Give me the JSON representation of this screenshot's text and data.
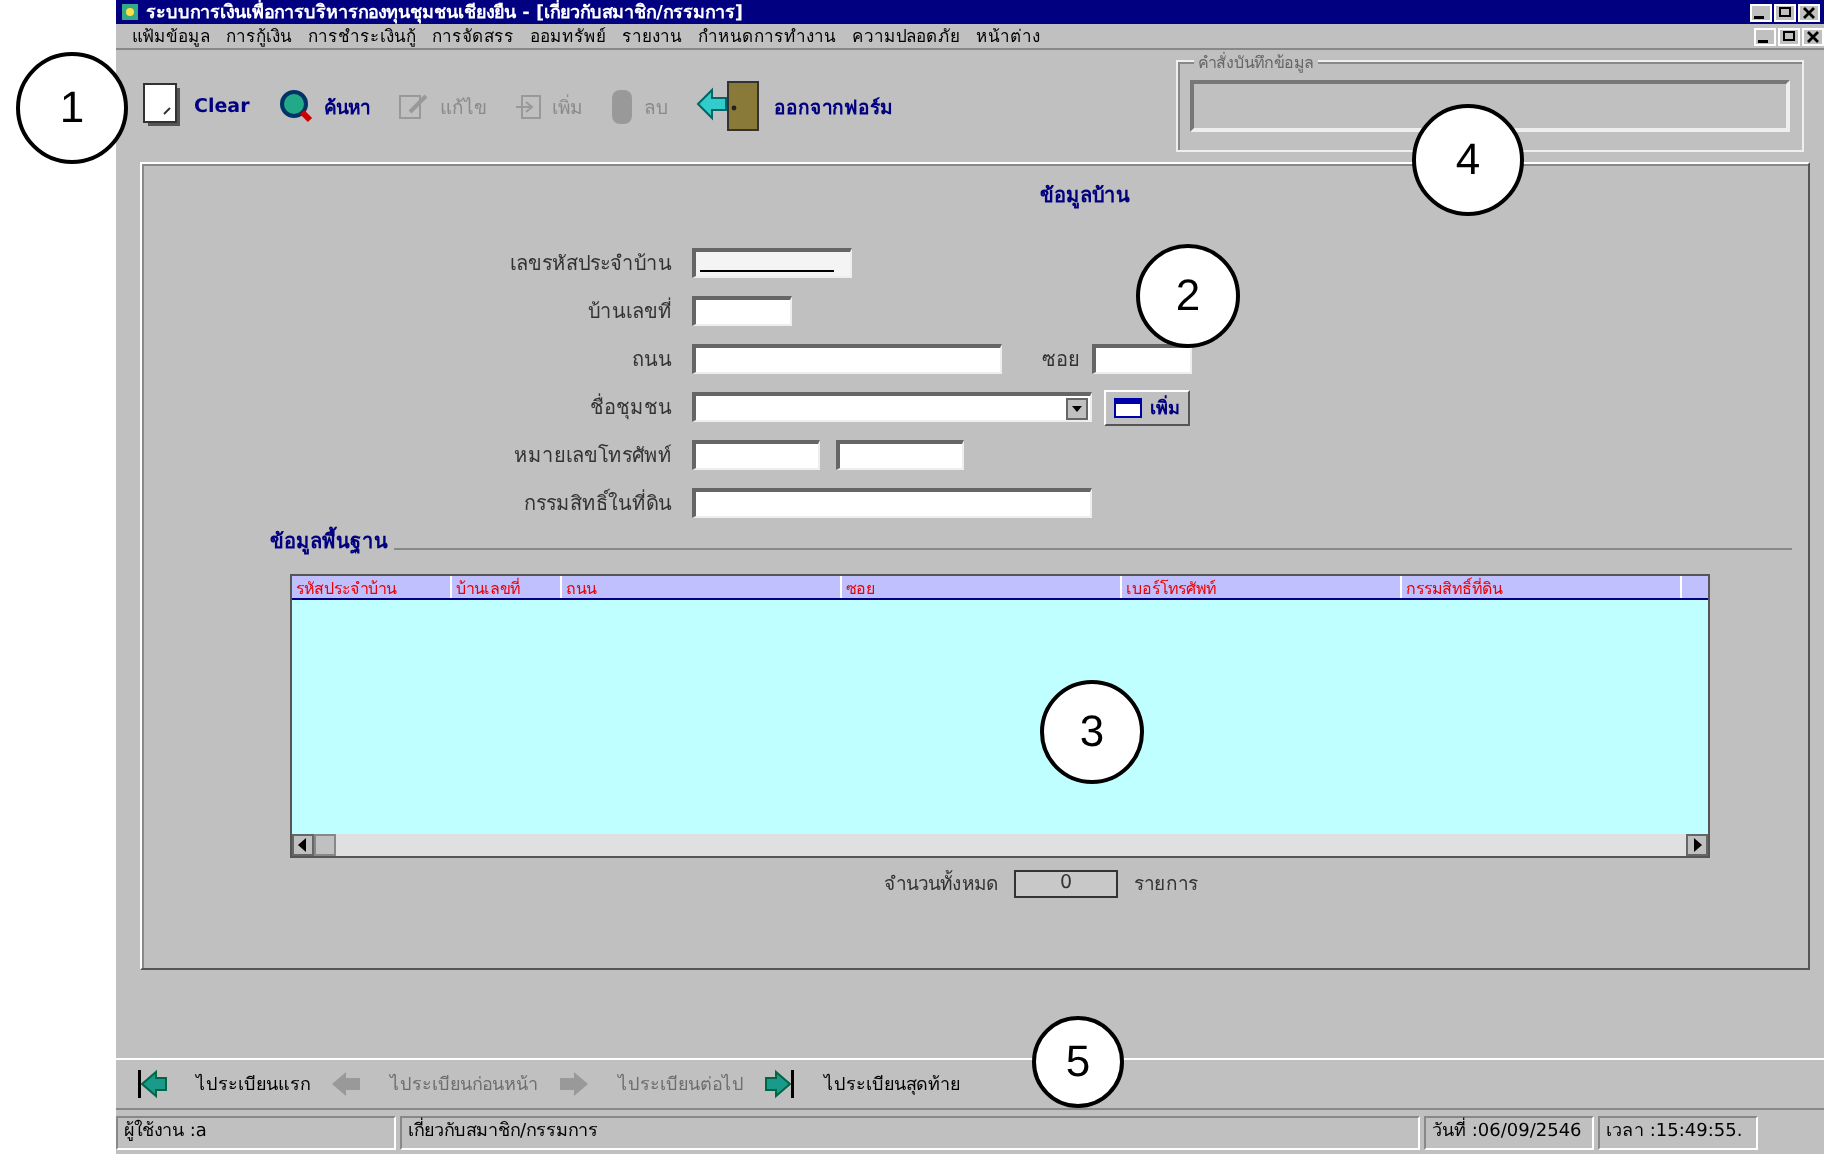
{
  "window": {
    "title": "ระบบการเงินเพื่อการบริหารกองทุนชุมชนเชียงยืน - [เกี่ยวกับสมาชิก/กรรมการ]"
  },
  "menu": [
    "แฟ้มข้อมูล",
    "การกู้เงิน",
    "การชำระเงินกู้",
    "การจัดสรร",
    "ออมทรัพย์",
    "รายงาน",
    "กำหนดการทำงาน",
    "ความปลอดภัย",
    "หน้าต่าง"
  ],
  "toolbar": [
    {
      "label": "Clear",
      "kind": "clear",
      "disabled": false
    },
    {
      "label": "ค้นหา",
      "kind": "search",
      "disabled": false
    },
    {
      "label": "แก้ไข",
      "kind": "edit",
      "disabled": true
    },
    {
      "label": "เพิ่ม",
      "kind": "add",
      "disabled": true
    },
    {
      "label": "ลบ",
      "kind": "delete",
      "disabled": true
    },
    {
      "label": "ออกจากฟอร์ม",
      "kind": "exit",
      "disabled": false
    }
  ],
  "record_group": {
    "label": "คำสั่งบันทึกข้อมูล"
  },
  "form": {
    "title": "ข้อมูลบ้าน",
    "rows": [
      [
        {
          "label": "เลขรหัสประจำบ้าน",
          "kind": "code"
        }
      ],
      [
        {
          "label": "บ้านเลขที่",
          "kind": "short"
        }
      ],
      [
        {
          "label": "ถนน",
          "kind": "medium"
        },
        {
          "label": "ซอย",
          "kind": "short"
        }
      ],
      [
        {
          "label": "ชื่อชุมชน",
          "kind": "combo",
          "button": "เพิ่ม"
        }
      ],
      [
        {
          "label": "หมายเลขโทรศัพท์",
          "kind": "phone"
        }
      ],
      [
        {
          "label": "กรรมสิทธิ์ในที่ดิน",
          "kind": "long"
        }
      ]
    ]
  },
  "basic": {
    "title": "ข้อมูลพื้นฐาน",
    "columns": [
      "รหัสประจำบ้าน",
      "บ้านเลขที่",
      "ถนน",
      "ซอย",
      "เบอร์โทรศัพท์",
      "กรรมสิทธิ์ที่ดิน"
    ],
    "count_label": "จำนวนทั้งหมด",
    "count": "0",
    "count_unit": "รายการ"
  },
  "nav": [
    {
      "label": "ไประเบียนแรก",
      "kind": "first",
      "disabled": false
    },
    {
      "label": "ไประเบียนก่อนหน้า",
      "kind": "prev",
      "disabled": true
    },
    {
      "label": "ไประเบียนต่อไป",
      "kind": "next",
      "disabled": true
    },
    {
      "label": "ไประเบียนสุดท้าย",
      "kind": "last",
      "disabled": false
    }
  ],
  "status_bar": [
    "ผู้ใช้งาน :a",
    "เกี่ยวกับสมาชิก/กรรมการ",
    "วันที่ :06/09/2546",
    "เวลา :15:49:55."
  ],
  "callouts": [
    "1",
    "2",
    "3",
    "4",
    "5"
  ]
}
